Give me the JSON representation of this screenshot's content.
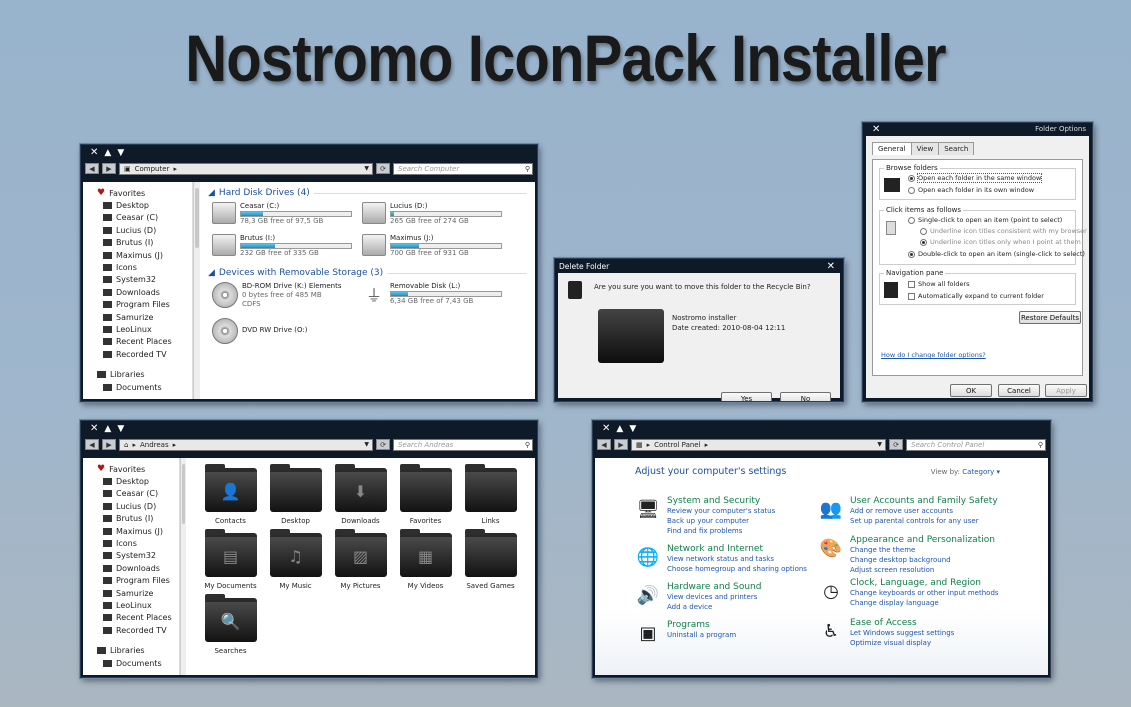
{
  "page_title": "Nostromo IconPack Installer",
  "window_controls": {
    "close": "✕",
    "min": "▲",
    "max": "▼"
  },
  "computer": {
    "address": "Computer",
    "search_placeholder": "Search Computer",
    "sidebar": [
      "Favorites",
      "Desktop",
      "Ceasar (C)",
      "Lucius (D)",
      "Brutus (I)",
      "Maximus (J)",
      "Icons",
      "System32",
      "Downloads",
      "Program Files",
      "Samurize",
      "LeoLinux",
      "Recent Places",
      "Recorded TV",
      "Libraries",
      "Documents"
    ],
    "group_hdd": "Hard Disk Drives (4)",
    "drives": [
      {
        "name": "Ceasar (C:)",
        "free": "78,3 GB free of 97,5 GB",
        "used": 0.2
      },
      {
        "name": "Lucius (D:)",
        "free": "265 GB free of 274 GB",
        "used": 0.03
      },
      {
        "name": "Brutus (I:)",
        "free": "232 GB free of 335 GB",
        "used": 0.31
      },
      {
        "name": "Maximus (J:)",
        "free": "700 GB free of 931 GB",
        "used": 0.25
      }
    ],
    "group_removable": "Devices with Removable Storage (3)",
    "removable": [
      {
        "name": "BD-ROM Drive (K:) Elements",
        "line2": "0 bytes free of 485 MB",
        "line3": "CDFS"
      },
      {
        "name": "Removable Disk (L:)",
        "free": "6,34 GB free of 7,43 GB",
        "used": 0.15
      },
      {
        "name": "DVD RW Drive (O:)"
      }
    ]
  },
  "delete_dialog": {
    "title": "Delete Folder",
    "question": "Are you sure you want to move this folder to the Recycle Bin?",
    "item_name": "Nostromo installer",
    "item_date": "Date created: 2010-08-04 12:11",
    "yes": "Yes",
    "no": "No"
  },
  "folder_options": {
    "title": "Folder Options",
    "tabs": [
      "General",
      "View",
      "Search"
    ],
    "browse_label": "Browse folders",
    "browse_opts": [
      "Open each folder in the same window",
      "Open each folder in its own window"
    ],
    "click_label": "Click items as follows",
    "click_opts": [
      "Single-click to open an item (point to select)",
      "Underline icon titles consistent with my browser",
      "Underline icon titles only when I point at them",
      "Double-click to open an item (single-click to select)"
    ],
    "nav_label": "Navigation pane",
    "nav_opts": [
      "Show all folders",
      "Automatically expand to current folder"
    ],
    "restore": "Restore Defaults",
    "help_link": "How do I change folder options?",
    "ok": "OK",
    "cancel": "Cancel",
    "apply": "Apply"
  },
  "andreas": {
    "address": "Andreas",
    "search_placeholder": "Search Andreas",
    "sidebar": [
      "Favorites",
      "Desktop",
      "Ceasar (C)",
      "Lucius (D)",
      "Brutus (I)",
      "Maximus (J)",
      "Icons",
      "System32",
      "Downloads",
      "Program Files",
      "Samurize",
      "LeoLinux",
      "Recent Places",
      "Recorded TV",
      "Libraries",
      "Documents"
    ],
    "folders": [
      "Contacts",
      "Desktop",
      "Downloads",
      "Favorites",
      "Links",
      "My Documents",
      "My Music",
      "My Pictures",
      "My Videos",
      "Saved Games",
      "Searches"
    ]
  },
  "control_panel": {
    "address": "Control Panel",
    "search_placeholder": "Search Control Panel",
    "heading": "Adjust your computer's settings",
    "view_by": "View by:",
    "view_value": "Category",
    "left": [
      {
        "title": "System and Security",
        "links": [
          "Review your computer's status",
          "Back up your computer",
          "Find and fix problems"
        ]
      },
      {
        "title": "Network and Internet",
        "links": [
          "View network status and tasks",
          "Choose homegroup and sharing options"
        ]
      },
      {
        "title": "Hardware and Sound",
        "links": [
          "View devices and printers",
          "Add a device"
        ]
      },
      {
        "title": "Programs",
        "links": [
          "Uninstall a program"
        ]
      }
    ],
    "right": [
      {
        "title": "User Accounts and Family Safety",
        "links": [
          "Add or remove user accounts",
          "Set up parental controls for any user"
        ]
      },
      {
        "title": "Appearance and Personalization",
        "links": [
          "Change the theme",
          "Change desktop background",
          "Adjust screen resolution"
        ]
      },
      {
        "title": "Clock, Language, and Region",
        "links": [
          "Change keyboards or other input methods",
          "Change display language"
        ]
      },
      {
        "title": "Ease of Access",
        "links": [
          "Let Windows suggest settings",
          "Optimize visual display"
        ]
      }
    ]
  }
}
